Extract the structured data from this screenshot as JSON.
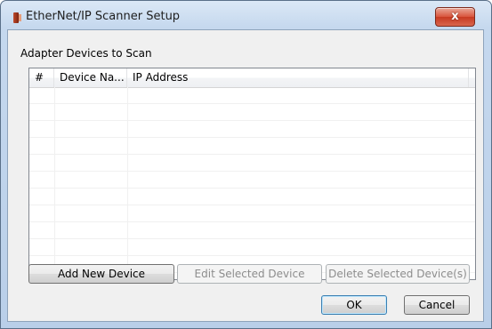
{
  "window": {
    "title": "EtherNet/IP Scanner Setup",
    "close_label": "x"
  },
  "group": {
    "label": "Adapter Devices to Scan"
  },
  "table": {
    "columns": [
      "#",
      "Device Na...",
      "IP Address"
    ],
    "rows": []
  },
  "actions": {
    "add_label": "Add New Device",
    "edit_label": "Edit Selected Device",
    "delete_label": "Delete Selected Device(s)"
  },
  "dialog_buttons": {
    "ok_label": "OK",
    "cancel_label": "Cancel"
  }
}
